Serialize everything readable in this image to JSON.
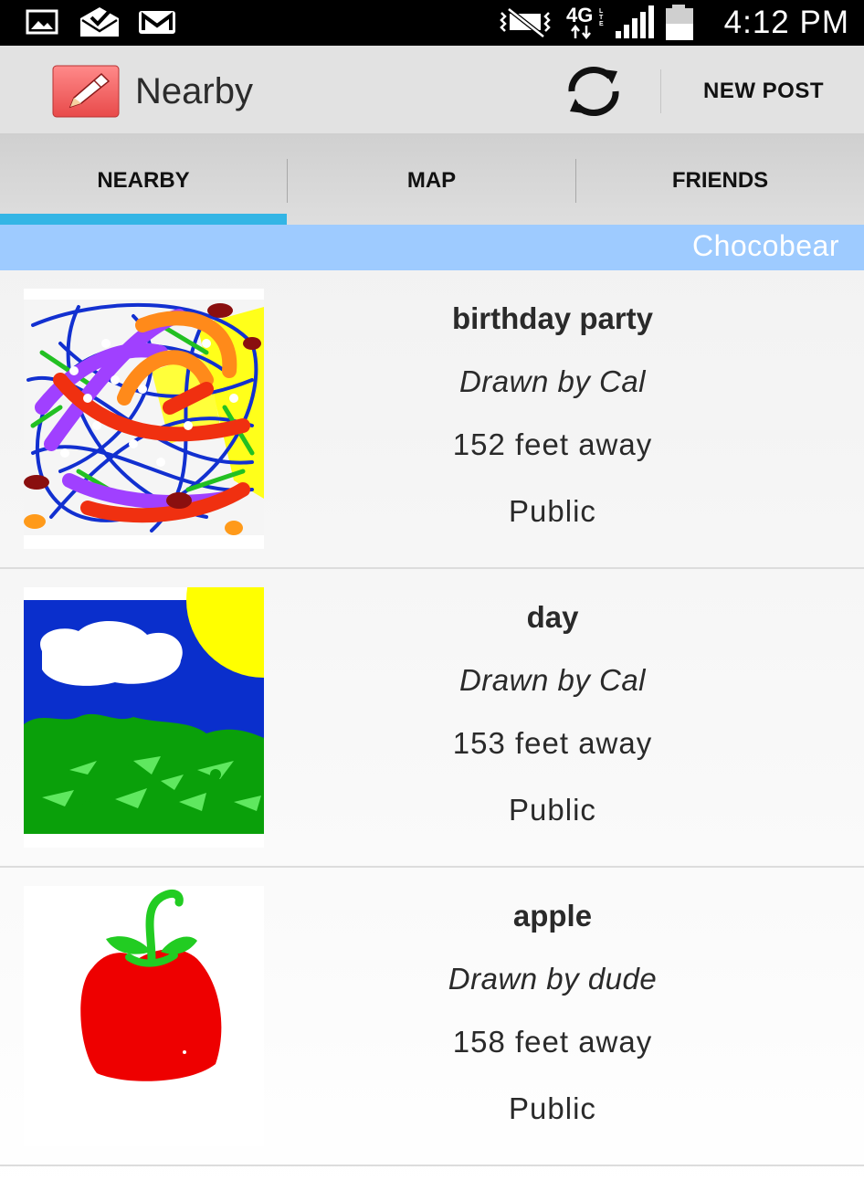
{
  "status_bar": {
    "time": "4:12 PM",
    "network": "4G LTE",
    "left_icons": [
      "gallery-notification-icon",
      "mail-checked-icon",
      "gmail-icon"
    ],
    "right_icons": [
      "vibrate-icon",
      "4g-lte-icon",
      "signal-icon",
      "battery-icon"
    ]
  },
  "action_bar": {
    "title": "Nearby",
    "new_post_label": "NEW POST",
    "app_icon": "pencil-icon",
    "refresh_icon": "refresh-icon"
  },
  "tabs": [
    {
      "label": "NEARBY",
      "selected": true
    },
    {
      "label": "MAP",
      "selected": false
    },
    {
      "label": "FRIENDS",
      "selected": false
    }
  ],
  "user_banner": {
    "username": "Chocobear"
  },
  "posts": [
    {
      "title": "birthday party",
      "author": "Drawn by Cal",
      "distance": "152 feet away",
      "visibility": "Public",
      "thumbnail": "scribble-drawing"
    },
    {
      "title": "day",
      "author": "Drawn by Cal",
      "distance": "153 feet away",
      "visibility": "Public",
      "thumbnail": "sky-cloud-sun-grass-drawing"
    },
    {
      "title": "apple",
      "author": "Drawn by dude",
      "distance": "158 feet away",
      "visibility": "Public",
      "thumbnail": "apple-drawing"
    }
  ],
  "colors": {
    "accent": "#33b5e5",
    "banner": "#9ecbff",
    "action_bar": "#e2e2e2",
    "status_bar": "#000000"
  }
}
